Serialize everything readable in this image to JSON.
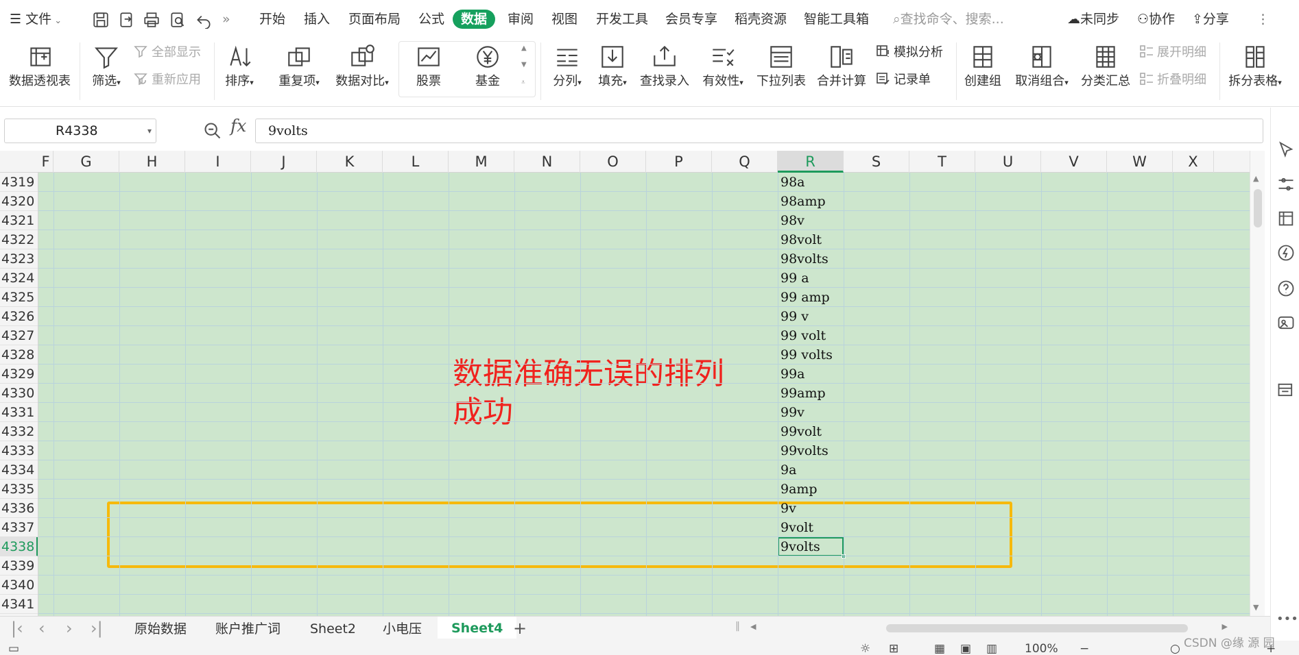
{
  "app": {
    "file_menu": "文件",
    "tabs": [
      "开始",
      "插入",
      "页面布局",
      "公式",
      "数据",
      "审阅",
      "视图",
      "开发工具",
      "会员专享",
      "稻壳资源",
      "智能工具箱"
    ],
    "active_tab": "数据",
    "search_placeholder": "查找命令、搜索...",
    "sync_label": "未同步",
    "collab_label": "协作",
    "share_label": "分享",
    "more_label": "⋮",
    "quick_more": "»"
  },
  "ribbon": {
    "pivot": "数据透视表",
    "filter": "筛选",
    "show_all": "全部显示",
    "reapply": "重新应用",
    "sort": "排序",
    "duplicates": "重复项",
    "compare": "数据对比",
    "stock": "股票",
    "fund": "基金",
    "split_col": "分列",
    "fill": "填充",
    "lookup_entry": "查找录入",
    "validity": "有效性",
    "dropdown_list": "下拉列表",
    "consolidate": "合并计算",
    "whatif": "模拟分析",
    "record_form": "记录单",
    "create_group": "创建组",
    "ungroup": "取消组合",
    "subtotal": "分类汇总",
    "expand_detail": "展开明细",
    "collapse_detail": "折叠明细",
    "split_table": "拆分表格"
  },
  "formula_bar": {
    "name_box": "R4338",
    "fx": "fx",
    "value": "9volts"
  },
  "grid": {
    "partial_left_col": "F",
    "columns": [
      "G",
      "H",
      "I",
      "J",
      "K",
      "L",
      "M",
      "N",
      "O",
      "P",
      "Q",
      "R",
      "S",
      "T",
      "U",
      "V",
      "W",
      "X"
    ],
    "selected_column": "R",
    "selected_row": "4338",
    "rows": [
      {
        "row": "4319",
        "r": "98a"
      },
      {
        "row": "4320",
        "r": "98amp"
      },
      {
        "row": "4321",
        "r": "98v"
      },
      {
        "row": "4322",
        "r": "98volt"
      },
      {
        "row": "4323",
        "r": "98volts"
      },
      {
        "row": "4324",
        "r": "99 a"
      },
      {
        "row": "4325",
        "r": "99 amp"
      },
      {
        "row": "4326",
        "r": "99 v"
      },
      {
        "row": "4327",
        "r": "99 volt"
      },
      {
        "row": "4328",
        "r": "99 volts"
      },
      {
        "row": "4329",
        "r": "99a"
      },
      {
        "row": "4330",
        "r": "99amp"
      },
      {
        "row": "4331",
        "r": "99v"
      },
      {
        "row": "4332",
        "r": "99volt"
      },
      {
        "row": "4333",
        "r": "99volts"
      },
      {
        "row": "4334",
        "r": "9a"
      },
      {
        "row": "4335",
        "r": "9amp"
      },
      {
        "row": "4336",
        "r": "9v"
      },
      {
        "row": "4337",
        "r": "9volt"
      },
      {
        "row": "4338",
        "r": "9volts"
      },
      {
        "row": "4339",
        "r": ""
      },
      {
        "row": "4340",
        "r": ""
      },
      {
        "row": "4341",
        "r": ""
      }
    ],
    "annotation": "数据准确无误的排列成功"
  },
  "sheets": {
    "tabs": [
      "原始数据",
      "账户推广词",
      "Sheet2",
      "小电压",
      "Sheet4"
    ],
    "active": "Sheet4",
    "add": "+"
  },
  "status": {
    "zoom": "100%",
    "watermark": "CSDN @缘 源 园"
  },
  "colors": {
    "accent": "#16a05d",
    "cell_fill": "#cde6cd",
    "annotation_text": "#f0221d",
    "highlight_box": "#f6b90c"
  }
}
